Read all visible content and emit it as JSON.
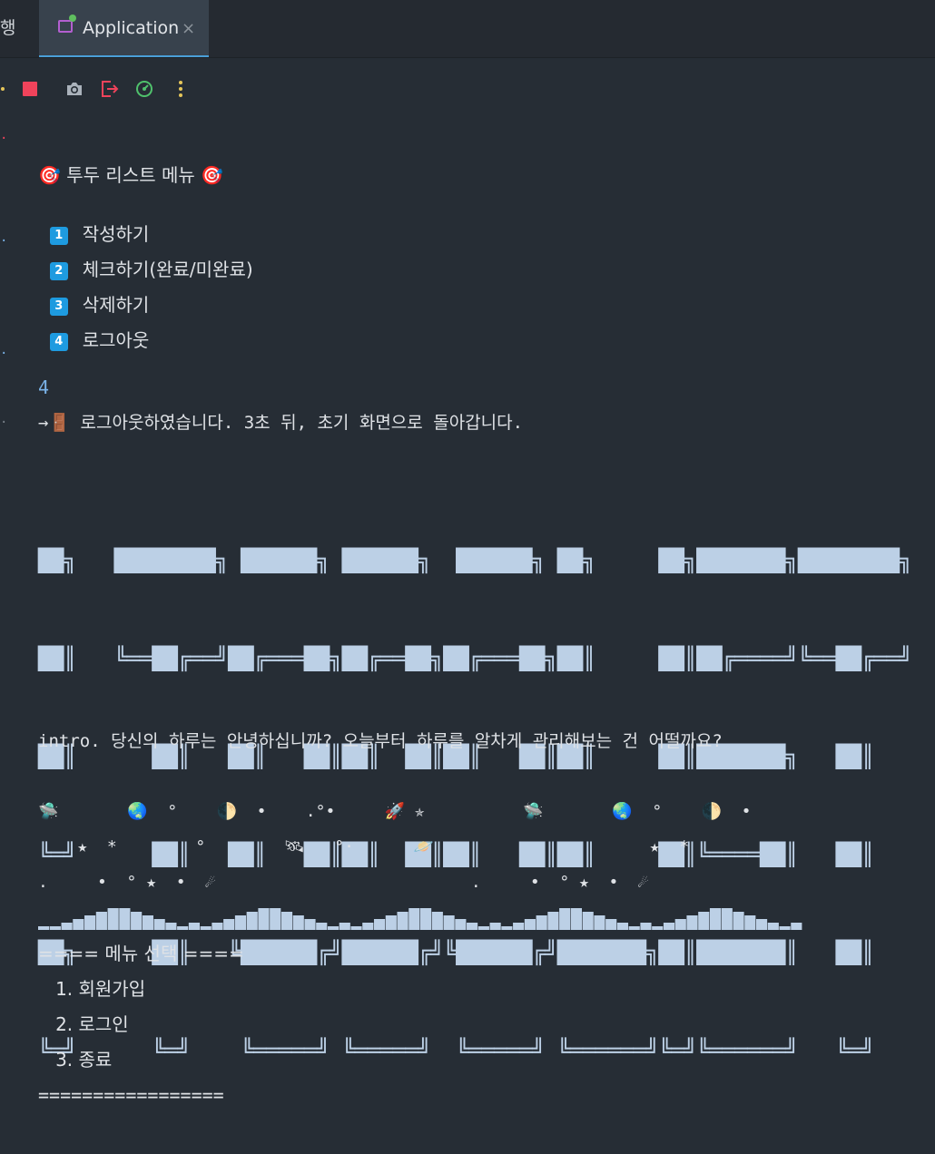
{
  "tabs": {
    "prev_label": "행",
    "active_label": "Application",
    "close_glyph": "×"
  },
  "toolbar": {
    "icons": [
      "rerun-icon",
      "stop-icon",
      "camera-icon",
      "exit-icon",
      "profiler-icon",
      "more-icon"
    ]
  },
  "menu": {
    "title": "🎯 투두 리스트 메뉴 🎯",
    "items": [
      {
        "num": "1",
        "label": "작성하기"
      },
      {
        "num": "2",
        "label": "체크하기(완료/미완료)"
      },
      {
        "num": "3",
        "label": "삭제하기"
      },
      {
        "num": "4",
        "label": "로그아웃"
      }
    ]
  },
  "input_echo": "4",
  "logout_message": "→🚪 로그아웃하였습니다. 3초 뒤, 초기 화면으로 돌아갑니다.",
  "banner_lines": [
    "██╗   ████████╗ ██████╗ ██████╗  ██████╗ ██╗     ██╗███████╗████████╗  ██╗",
    "██║   ╚══██╔══╝██╔═══██╗██╔══██╗██╔═══██╗██║     ██║██╔════╝╚══██╔══╝  ██║",
    "██║      ██║   ██║   ██║██║  ██║██║   ██║██║     ██║███████╗   ██║     ██║",
    "╚═╝      ██║   ██║   ██║██║  ██║██║   ██║██║     ██║╚════██║   ██║     ╚═╝",
    "██╗      ██║   ╚██████╔╝██████╔╝╚██████╔╝███████╗██║███████║   ██║     ██╗",
    "╚═╝      ╚═╝    ╚═════╝ ╚═════╝  ╚═════╝ ╚══════╝╚═╝╚══════╝   ╚═╝     ╚═╝"
  ],
  "intro": "intro. 당신의 하루는 안녕하십니까? 오늘부터 하루를 알차게 관리해보는 건 어떨까요?",
  "space_lines": [
    "🛸       🌏  °    🌓  •    .°•     🚀 ✯          🛸       🌏  °    🌓  •",
    "    ★  *        °        🛰   °·      🪐                      ★  *",
    ".     •  ° ★  •  ☄                          .     •  ° ★  •  ☄"
  ],
  "mountain": {
    "heights": [
      1,
      1,
      2,
      3,
      4,
      5,
      6,
      6,
      5,
      4,
      3,
      2,
      1,
      2,
      1,
      2,
      3,
      4,
      5,
      6,
      6,
      5,
      4,
      3,
      2,
      1,
      2,
      1,
      2,
      3,
      4,
      5,
      6,
      6,
      5,
      4,
      3,
      2,
      1,
      2,
      1,
      2,
      3,
      4,
      5,
      6,
      6,
      5,
      4,
      3,
      2,
      1,
      2,
      1,
      2,
      3,
      4,
      5,
      6,
      6,
      5,
      4,
      3,
      2,
      1,
      2
    ]
  },
  "main_menu": {
    "header": "==== 메뉴 선택 ====",
    "items": [
      "   1. 회원가입",
      "   2. 로그인",
      "   3. 종료"
    ],
    "footer": "================="
  },
  "colors": {
    "background": "#262d35",
    "banner": "#bcd0e6",
    "badge": "#1e9be0",
    "tab_underline": "#4a9fd8",
    "stop": "#f0435b",
    "input_echo": "#7ab3e8"
  }
}
